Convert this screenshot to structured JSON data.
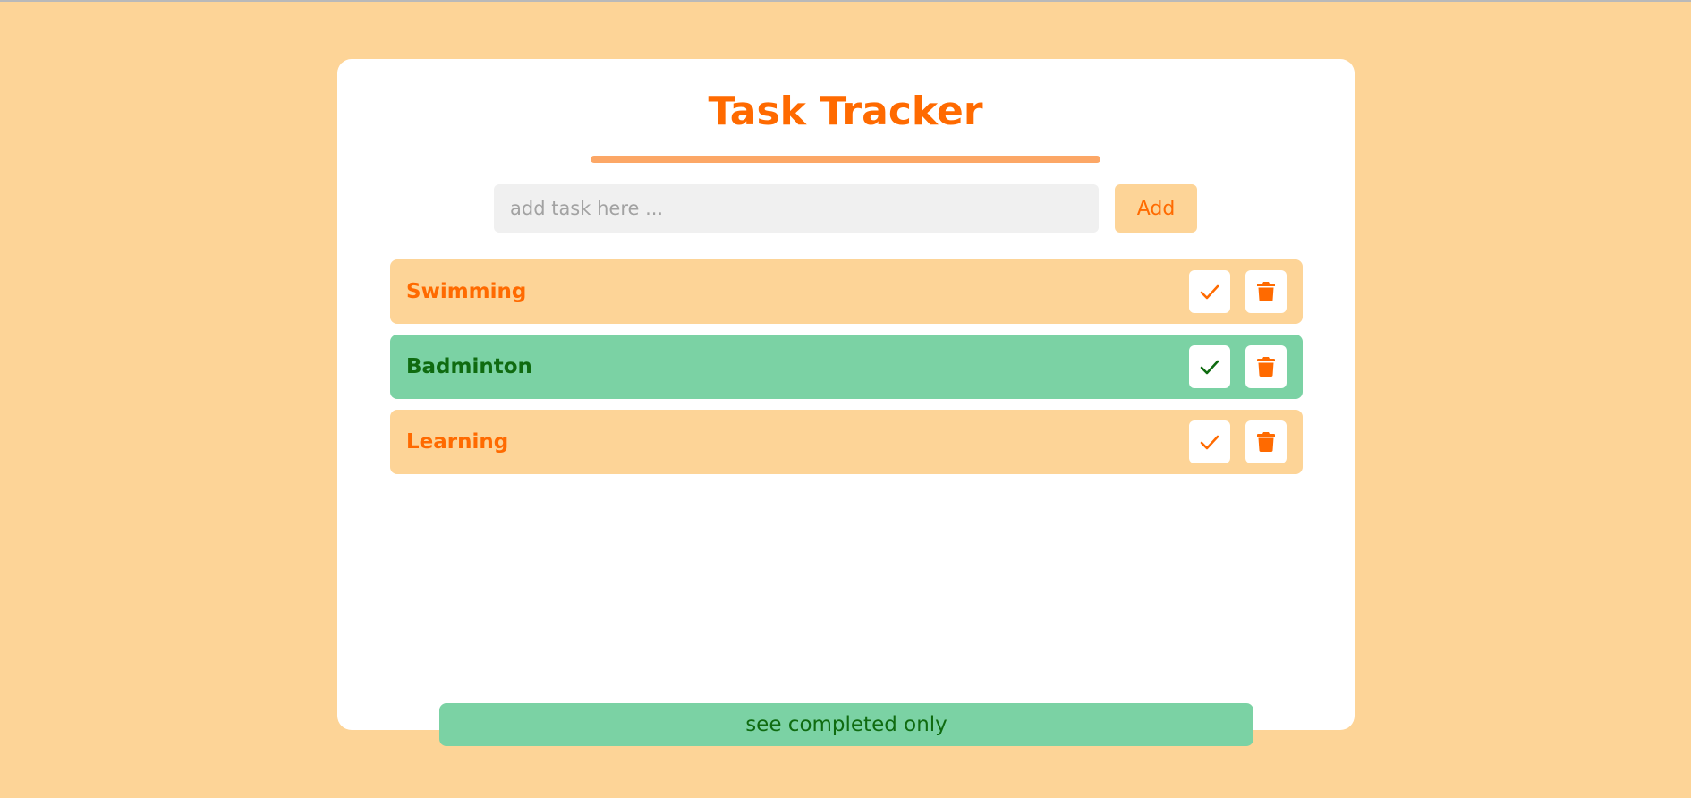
{
  "app": {
    "title": "Task Tracker"
  },
  "input": {
    "placeholder": "add task here ...",
    "value": ""
  },
  "add_button": {
    "label": "Add"
  },
  "tasks": [
    {
      "label": "Swimming",
      "completed": false
    },
    {
      "label": "Badminton",
      "completed": true
    },
    {
      "label": "Learning",
      "completed": false
    }
  ],
  "icons": {
    "complete": "check-icon",
    "delete": "trash-icon"
  },
  "filter_button": {
    "label": "see completed only"
  },
  "colors": {
    "background": "#fdd497",
    "accent": "#ff6a00",
    "completed_bg": "#7bd2a4",
    "completed_text": "#0f6b10",
    "underline": "#fca766"
  }
}
